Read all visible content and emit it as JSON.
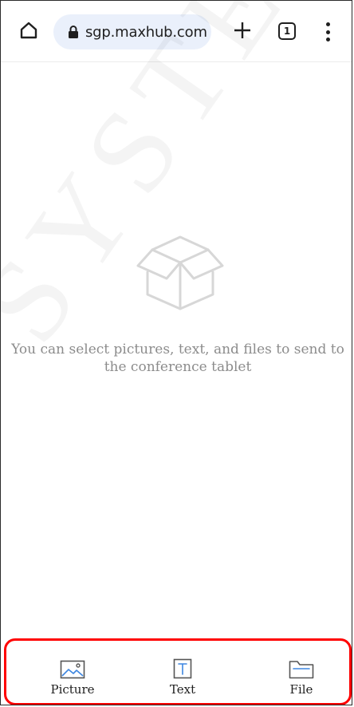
{
  "browser": {
    "url": "sgp.maxhub.com",
    "tab_count": "1",
    "icons": {
      "home": "home-icon",
      "lock": "lock-icon",
      "new_tab": "plus-icon",
      "menu": "more-vert-icon"
    }
  },
  "watermark": {
    "text": "SYSTEM"
  },
  "empty_state": {
    "icon": "open-box-icon",
    "message": "You can select pictures, text, and files to send to the conference tablet"
  },
  "bottom_bar": {
    "highlight_color": "#ff0000",
    "accent_color": "#3d86e0",
    "items": [
      {
        "label": "Picture",
        "icon": "image-icon"
      },
      {
        "label": "Text",
        "icon": "text-icon"
      },
      {
        "label": "File",
        "icon": "folder-icon"
      }
    ]
  }
}
